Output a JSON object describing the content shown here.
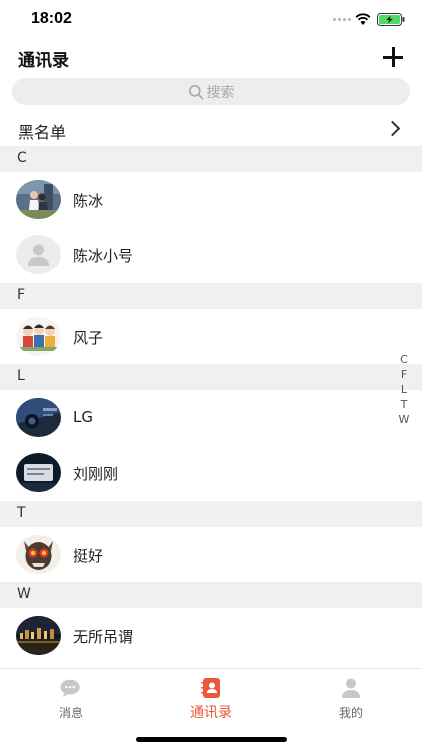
{
  "status": {
    "time": "18:02"
  },
  "nav": {
    "title": "通讯录"
  },
  "search": {
    "placeholder": "搜索"
  },
  "blacklist": {
    "label": "黑名单"
  },
  "sections": [
    {
      "letter": "C",
      "contacts": [
        {
          "name": "陈冰"
        },
        {
          "name": "陈冰小号"
        }
      ]
    },
    {
      "letter": "F",
      "contacts": [
        {
          "name": "风子"
        }
      ]
    },
    {
      "letter": "L",
      "contacts": [
        {
          "name": "LG"
        },
        {
          "name": "刘刚刚"
        }
      ]
    },
    {
      "letter": "T",
      "contacts": [
        {
          "name": "挺好"
        }
      ]
    },
    {
      "letter": "W",
      "contacts": [
        {
          "name": "无所吊谓"
        }
      ]
    }
  ],
  "index_letters": [
    "C",
    "F",
    "L",
    "T",
    "W"
  ],
  "tabs": [
    {
      "label": "消息",
      "icon": "chat-bubble-icon",
      "active": false
    },
    {
      "label": "通讯录",
      "icon": "contacts-book-icon",
      "active": true
    },
    {
      "label": "我的",
      "icon": "profile-icon",
      "active": false
    }
  ],
  "colors": {
    "accent": "#e95a3a",
    "section_bg": "#f0f0f0",
    "search_bg": "#ededed",
    "battery": "#4cd964"
  }
}
